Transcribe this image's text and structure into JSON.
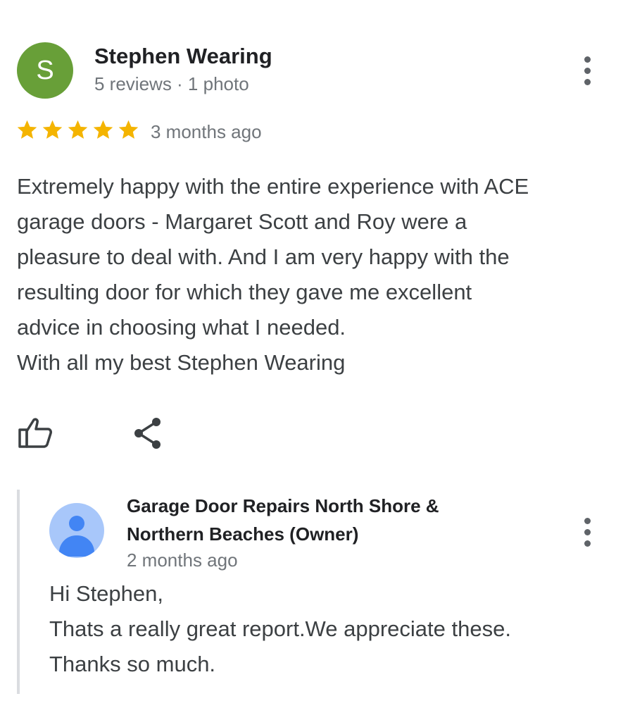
{
  "review": {
    "avatar_initial": "S",
    "avatar_color": "#689f38",
    "reviewer_name": "Stephen Wearing",
    "reviewer_meta": "5 reviews · 1 photo",
    "rating": 5,
    "rating_max": 5,
    "star_color": "#f4b400",
    "date": "3 months ago",
    "text_lines": [
      "Extremely happy with the entire experience with ACE",
      "garage doors - Margaret Scott and Roy were a",
      "pleasure to deal with. And I am very happy with the",
      "resulting door for which they gave me excellent",
      "advice in choosing what I needed.",
      "With all my best Stephen Wearing"
    ],
    "actions": [
      {
        "icon": "thumbs-up-icon"
      },
      {
        "icon": "share-icon"
      }
    ],
    "more_icon": "more-vert-icon"
  },
  "reply": {
    "avatar_icon": "default-person-icon",
    "avatar_color": "#a8c7fa",
    "owner_name_lines": [
      "Garage Door Repairs North Shore &",
      "Northern Beaches (Owner)"
    ],
    "date": "2 months ago",
    "text_lines": [
      "Hi Stephen,",
      "Thats a really great report.We appreciate these.",
      "Thanks so much."
    ],
    "more_icon": "more-vert-icon"
  }
}
